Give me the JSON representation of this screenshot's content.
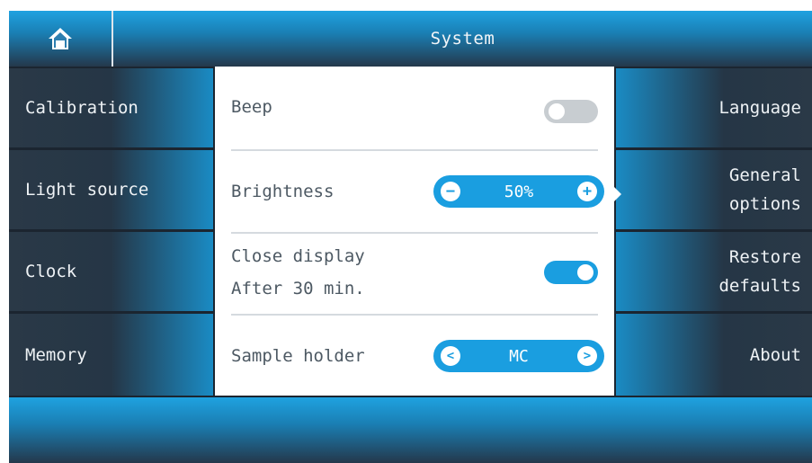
{
  "header": {
    "title": "System",
    "home_icon": "home-icon"
  },
  "left_menu": [
    {
      "label": "Calibration"
    },
    {
      "label": "Light source"
    },
    {
      "label": "Clock"
    },
    {
      "label": "Memory"
    }
  ],
  "right_menu": [
    {
      "label": "Language"
    },
    {
      "label": "General\noptions",
      "selected": true
    },
    {
      "label": "Restore\ndefaults"
    },
    {
      "label": "About"
    }
  ],
  "settings": {
    "beep": {
      "label": "Beep",
      "on": false
    },
    "brightness": {
      "label": "Brightness",
      "value": "50%"
    },
    "close_display": {
      "label_line1": "Close display",
      "label_line2": "After 30 min.",
      "on": true
    },
    "sample_holder": {
      "label": "Sample holder",
      "value": "MC"
    }
  },
  "colors": {
    "accent": "#1a9ee0",
    "dark": "#2a3947",
    "toggle_off": "#c8cdd1"
  }
}
